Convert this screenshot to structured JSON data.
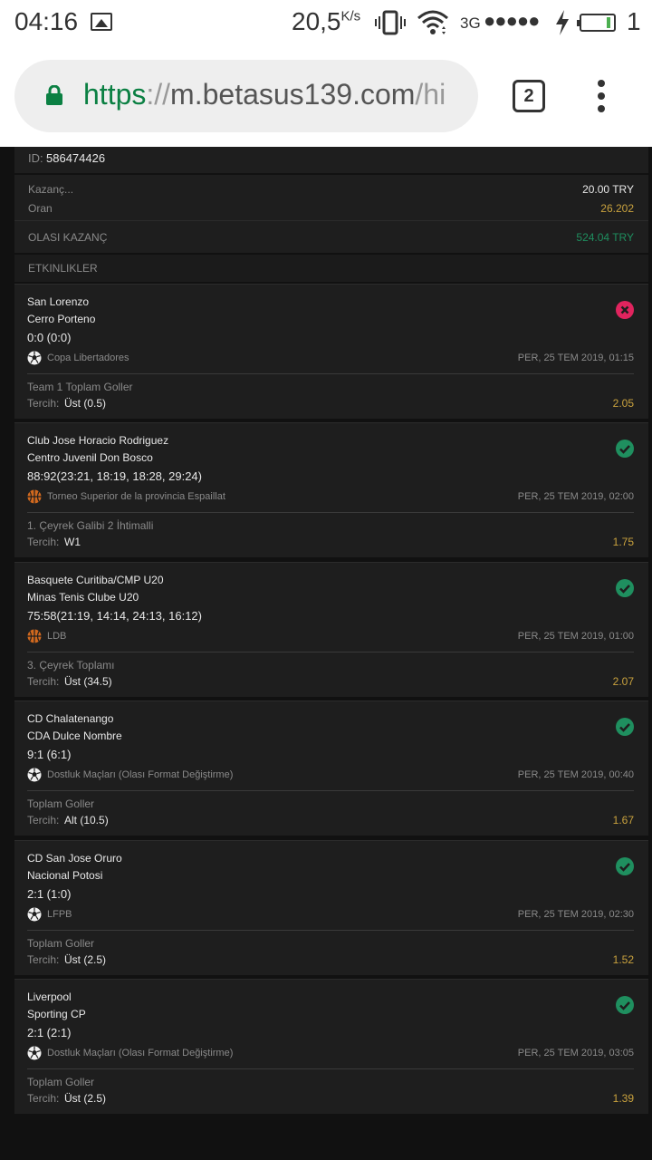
{
  "status_bar": {
    "time": "04:16",
    "speed": "20,5",
    "speed_unit": "K/s",
    "network": "3G",
    "signal_dots": "●●●●●",
    "battery_level": "1"
  },
  "browser": {
    "url_scheme": "https",
    "url_sep": "://",
    "url_host": "m.betasus139.com",
    "url_rest": "/hi",
    "tab_count": "2"
  },
  "coupon": {
    "id_label": "ID:",
    "id_value": "586474426",
    "stake_label": "Kazanç...",
    "stake_value": "20.00 TRY",
    "odds_label": "Oran",
    "odds_value": "26.202",
    "potential_label": "OLASI KAZANÇ",
    "potential_value": "524.04 TRY",
    "events_header": "ETKINLIKLER"
  },
  "events": [
    {
      "team1": "San Lorenzo",
      "team2": "Cerro Porteno",
      "score": "0:0 (0:0)",
      "sport": "football",
      "league": "Copa Libertadores",
      "datetime": "PER, 25 TEM 2019, 01:15",
      "market": "Team 1 Toplam Goller",
      "choice_label": "Tercih:",
      "choice": "Üst (0.5)",
      "odds": "2.05",
      "result": "lost"
    },
    {
      "team1": "Club Jose Horacio Rodriguez",
      "team2": "Centro Juvenil Don Bosco",
      "score": "88:92(23:21, 18:19, 18:28, 29:24)",
      "sport": "basketball",
      "league": "Torneo Superior de la provincia Espaillat",
      "datetime": "PER, 25 TEM 2019, 02:00",
      "market": "1. Çeyrek Galibi 2 İhtimalli",
      "choice_label": "Tercih:",
      "choice": "W1",
      "odds": "1.75",
      "result": "won"
    },
    {
      "team1": "Basquete Curitiba/CMP U20",
      "team2": "Minas Tenis Clube U20",
      "score": "75:58(21:19, 14:14, 24:13, 16:12)",
      "sport": "basketball",
      "league": "LDB",
      "datetime": "PER, 25 TEM 2019, 01:00",
      "market": "3. Çeyrek Toplamı",
      "choice_label": "Tercih:",
      "choice": "Üst (34.5)",
      "odds": "2.07",
      "result": "won"
    },
    {
      "team1": "CD Chalatenango",
      "team2": "CDA Dulce Nombre",
      "score": "9:1 (6:1)",
      "sport": "football",
      "league": "Dostluk Maçları (Olası Format Değiştirme)",
      "datetime": "PER, 25 TEM 2019, 00:40",
      "market": "Toplam Goller",
      "choice_label": "Tercih:",
      "choice": "Alt (10.5)",
      "odds": "1.67",
      "result": "won"
    },
    {
      "team1": "CD San Jose Oruro",
      "team2": "Nacional Potosi",
      "score": "2:1 (1:0)",
      "sport": "football",
      "league": "LFPB",
      "datetime": "PER, 25 TEM 2019, 02:30",
      "market": "Toplam Goller",
      "choice_label": "Tercih:",
      "choice": "Üst (2.5)",
      "odds": "1.52",
      "result": "won"
    },
    {
      "team1": "Liverpool",
      "team2": "Sporting CP",
      "score": "2:1 (2:1)",
      "sport": "football",
      "league": "Dostluk Maçları (Olası Format Değiştirme)",
      "datetime": "PER, 25 TEM 2019, 03:05",
      "market": "Toplam Goller",
      "choice_label": "Tercih:",
      "choice": "Üst (2.5)",
      "odds": "1.39",
      "result": "won"
    }
  ],
  "colors": {
    "won": "#1f8f5f",
    "lost": "#e0245e",
    "odds": "#c9a23e",
    "potential": "#1f8f5f",
    "url_scheme": "#0b8043"
  }
}
